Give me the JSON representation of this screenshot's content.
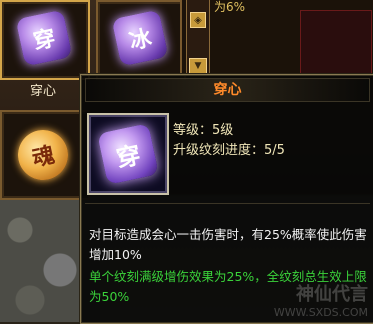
{
  "background": {
    "top_stat": "为6%",
    "slot_1_label": "穿心"
  },
  "tooltip": {
    "title": "穿心",
    "level_line": "等级：5级",
    "progress_line": "升级纹刻进度：5/5",
    "description_white": "对目标造成会心一击伤害时，有25%概率使此伤害增加10%",
    "description_green": "单个纹刻满级增伤效果为25%，全纹刻总生效上限为50%",
    "icon_glyph": "穿"
  },
  "watermark": {
    "text": "神仙代言",
    "url": "WWW.SXDS.COM"
  },
  "colors": {
    "title": "#ff8a2a",
    "green_text": "#3ad23a",
    "frame_gold": "#7a5a2e"
  }
}
